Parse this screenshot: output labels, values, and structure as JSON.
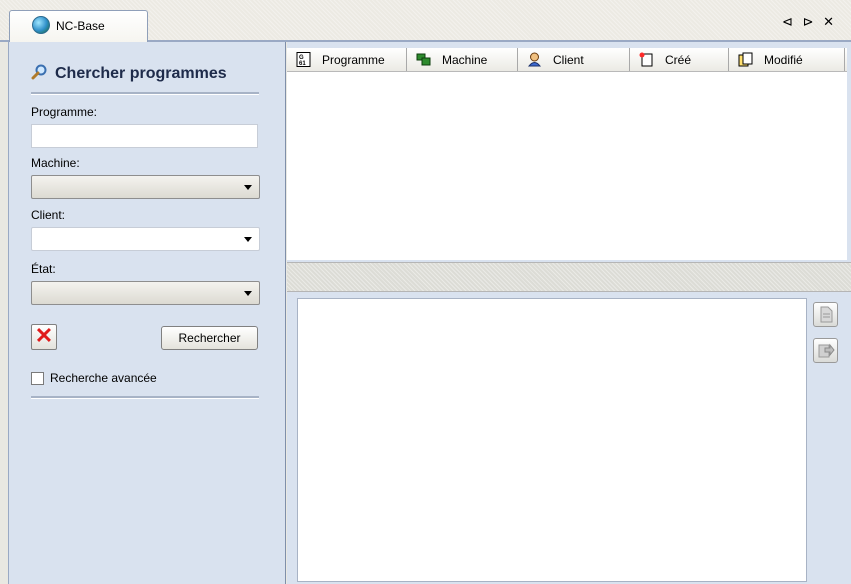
{
  "tab": {
    "label": "NC-Base"
  },
  "window_controls": {
    "prev": "⊲",
    "next": "⊳",
    "close": "✕"
  },
  "search_panel": {
    "title": "Chercher programmes",
    "programme_label": "Programme:",
    "programme_value": "",
    "machine_label": "Machine:",
    "machine_value": "",
    "client_label": "Client:",
    "client_value": "",
    "etat_label": "État:",
    "etat_value": "",
    "clear_symbol": "✕",
    "search_button": "Rechercher",
    "advanced_label": "Recherche avancée",
    "advanced_checked": false
  },
  "grid": {
    "columns": [
      {
        "label": "Programme",
        "icon": "g61-file-icon"
      },
      {
        "label": "Machine",
        "icon": "machine-icon"
      },
      {
        "label": "Client",
        "icon": "client-icon"
      },
      {
        "label": "Créé",
        "icon": "new-document-icon"
      },
      {
        "label": "Modifié",
        "icon": "modified-document-icon"
      }
    ],
    "rows": []
  },
  "colors": {
    "panel_bg": "#d9e2ef",
    "accent_red": "#e01b1b",
    "title_color": "#1e2b4a"
  }
}
